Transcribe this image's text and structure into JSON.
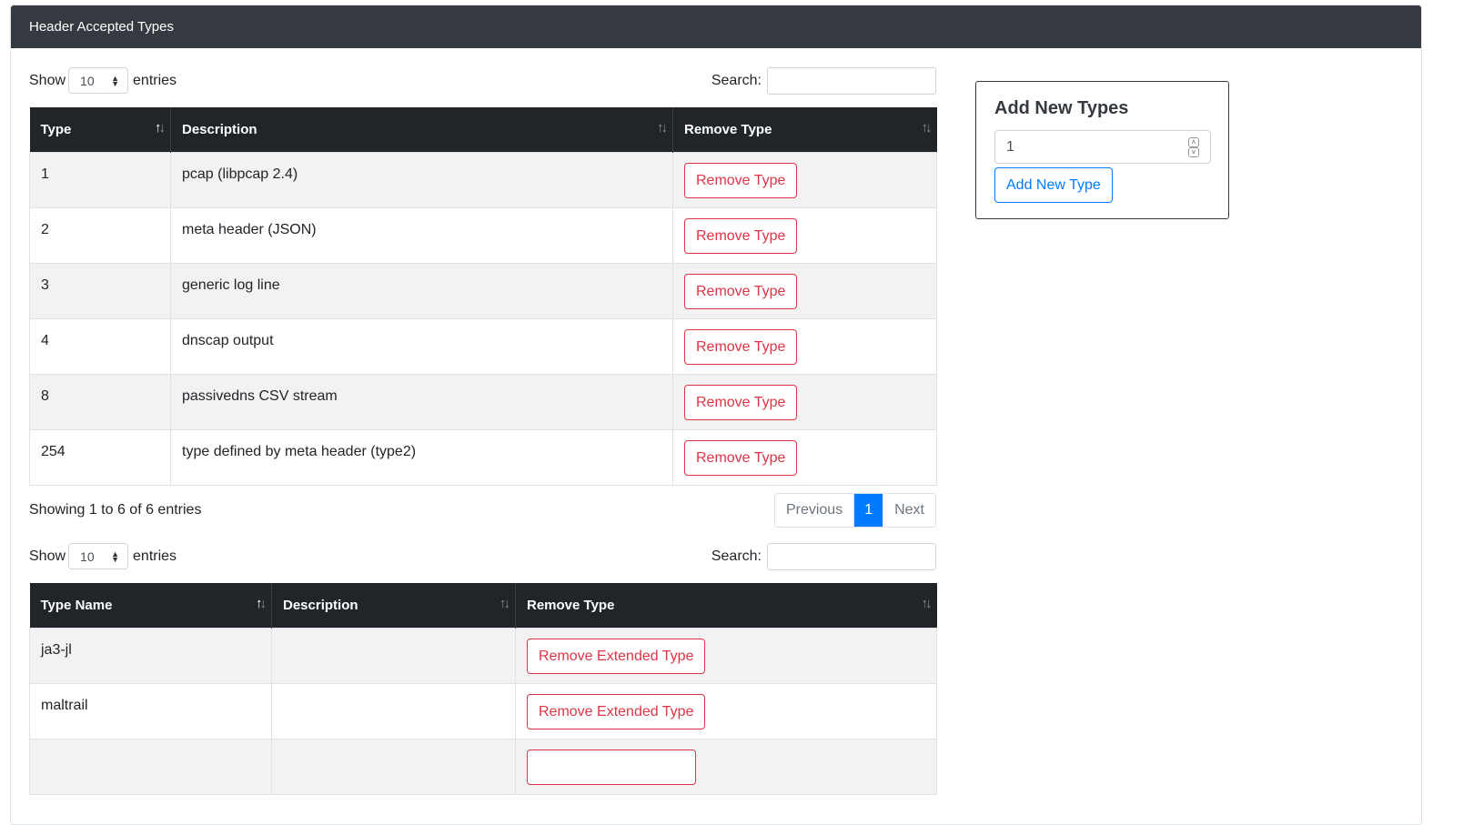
{
  "header": {
    "title": "Header Accepted Types"
  },
  "table1": {
    "show_label": "Show",
    "entries_label": "entries",
    "page_length": "10",
    "search_label": "Search:",
    "columns": [
      "Type",
      "Description",
      "Remove Type"
    ],
    "rows": [
      {
        "type": "1",
        "description": "pcap (libpcap 2.4)",
        "action": "Remove Type"
      },
      {
        "type": "2",
        "description": "meta header (JSON)",
        "action": "Remove Type"
      },
      {
        "type": "3",
        "description": "generic log line",
        "action": "Remove Type"
      },
      {
        "type": "4",
        "description": "dnscap output",
        "action": "Remove Type"
      },
      {
        "type": "8",
        "description": "passivedns CSV stream",
        "action": "Remove Type"
      },
      {
        "type": "254",
        "description": "type defined by meta header (type2)",
        "action": "Remove Type"
      }
    ],
    "info": "Showing 1 to 6 of 6 entries",
    "pagination": {
      "previous": "Previous",
      "current": "1",
      "next": "Next"
    }
  },
  "table2": {
    "show_label": "Show",
    "entries_label": "entries",
    "page_length": "10",
    "search_label": "Search:",
    "columns": [
      "Type Name",
      "Description",
      "Remove Type"
    ],
    "rows": [
      {
        "name": "ja3-jl",
        "description": "",
        "action": "Remove Extended Type"
      },
      {
        "name": "maltrail",
        "description": "",
        "action": "Remove Extended Type"
      }
    ]
  },
  "add_panel": {
    "title": "Add New Types",
    "value": "1",
    "button": "Add New Type"
  },
  "colors": {
    "header_bg": "#343a40",
    "table_head_bg": "#212529",
    "danger": "#dc3545",
    "primary": "#007bff"
  }
}
